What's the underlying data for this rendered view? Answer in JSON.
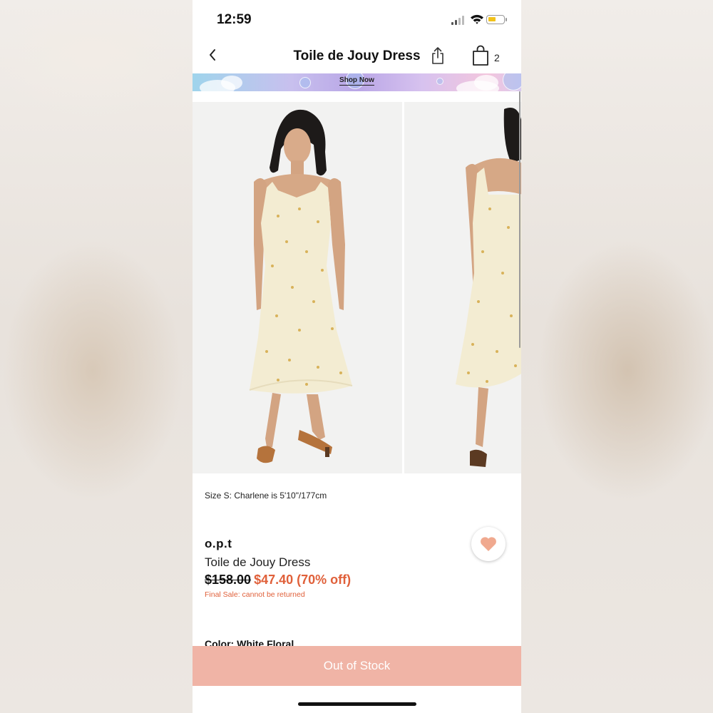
{
  "status_bar": {
    "time": "12:59"
  },
  "nav": {
    "title": "Toile de Jouy Dress",
    "bag_count": "2"
  },
  "banner": {
    "label": "Shop Now"
  },
  "product": {
    "size_note": "Size S: Charlene is 5'10\"/177cm",
    "brand": "o.p.t",
    "name": "Toile de Jouy Dress",
    "original_price": "$158.00",
    "sale_price": "$47.40 (70% off)",
    "final_sale_note": "Final Sale: cannot be returned",
    "color_label": "Color: White Floral"
  },
  "action": {
    "out_of_stock_label": "Out of Stock"
  },
  "colors": {
    "sale": "#e0603a",
    "button": "#f0b4a6",
    "heart": "#f0a98f"
  }
}
